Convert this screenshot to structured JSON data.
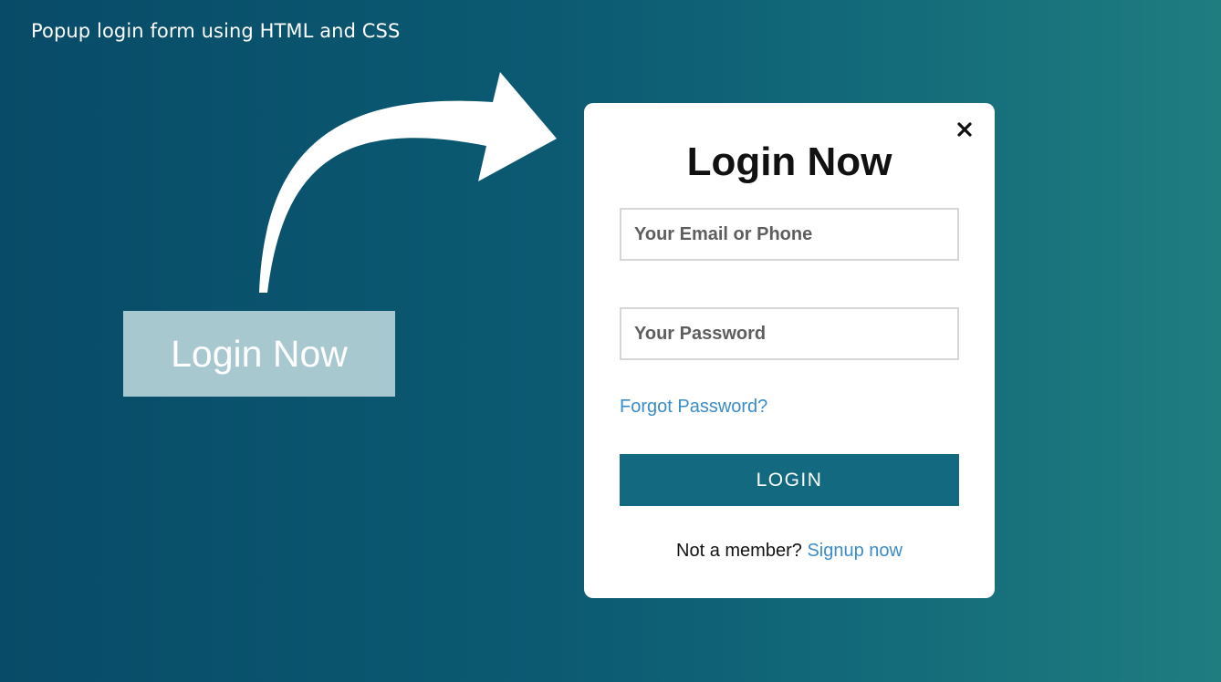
{
  "caption": "Popup login form using HTML and CSS",
  "trigger_button": {
    "label": "Login Now"
  },
  "popup": {
    "close_icon": "close-icon",
    "title": "Login Now",
    "email_placeholder": "Your Email or Phone",
    "password_placeholder": "Your Password",
    "forgot_password": "Forgot Password?",
    "login_button": "LOGIN",
    "signup_prompt": "Not a member?",
    "signup_link": "Signup now"
  },
  "colors": {
    "background_start": "#084b68",
    "background_end": "#1f7d80",
    "trigger_button_bg": "#a8c8d0",
    "login_button_bg": "#136a80",
    "link": "#3a8cc8"
  }
}
